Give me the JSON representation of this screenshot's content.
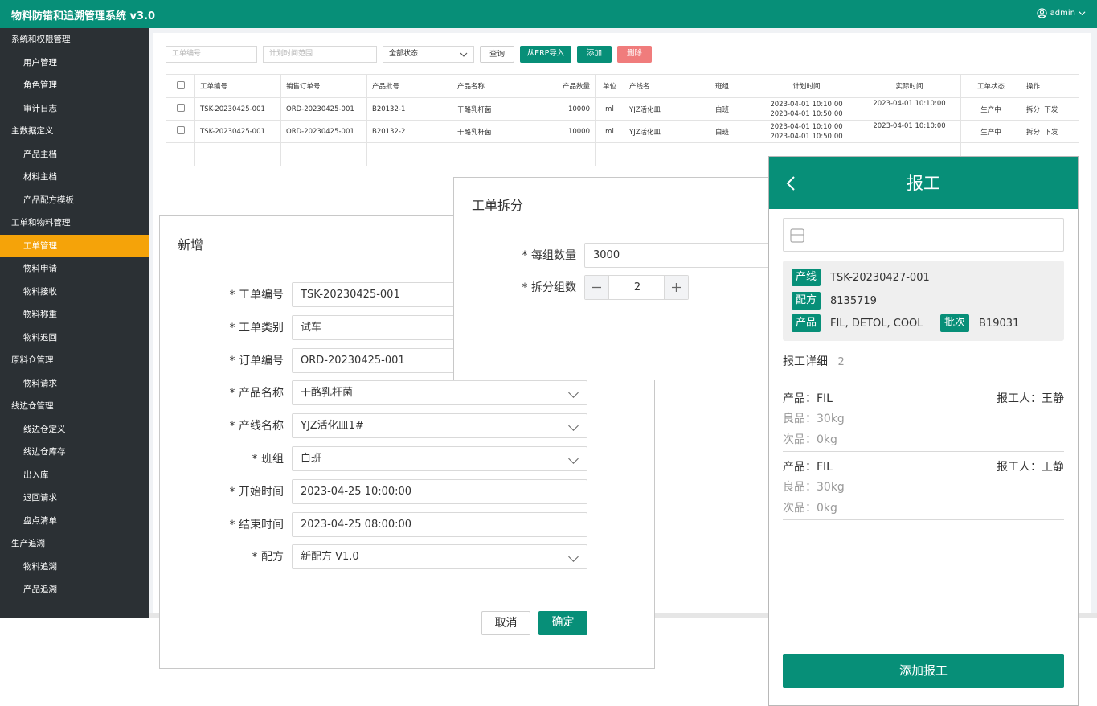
{
  "app": {
    "title": "物料防错和追溯管理系统 v3.0",
    "user": "admin"
  },
  "sidebar": {
    "items": [
      {
        "label": "系统和权限管理",
        "kind": "group"
      },
      {
        "label": "用户管理",
        "kind": "child"
      },
      {
        "label": "角色管理",
        "kind": "child"
      },
      {
        "label": "审计日志",
        "kind": "child"
      },
      {
        "label": "主数据定义",
        "kind": "group"
      },
      {
        "label": "产品主档",
        "kind": "child"
      },
      {
        "label": "材料主档",
        "kind": "child"
      },
      {
        "label": "产品配方模板",
        "kind": "child"
      },
      {
        "label": "工单和物料管理",
        "kind": "group"
      },
      {
        "label": "工单管理",
        "kind": "child",
        "active": true
      },
      {
        "label": "物料申请",
        "kind": "child"
      },
      {
        "label": "物料接收",
        "kind": "child"
      },
      {
        "label": "物料称重",
        "kind": "child"
      },
      {
        "label": "物料退回",
        "kind": "child"
      },
      {
        "label": "原料仓管理",
        "kind": "group"
      },
      {
        "label": "物料请求",
        "kind": "child"
      },
      {
        "label": "线边仓管理",
        "kind": "group"
      },
      {
        "label": "线边仓定义",
        "kind": "child"
      },
      {
        "label": "线边仓库存",
        "kind": "child"
      },
      {
        "label": "出入库",
        "kind": "child"
      },
      {
        "label": "退回请求",
        "kind": "child"
      },
      {
        "label": "盘点清单",
        "kind": "child"
      },
      {
        "label": "生产追溯",
        "kind": "group"
      },
      {
        "label": "物料追溯",
        "kind": "child"
      },
      {
        "label": "产品追溯",
        "kind": "child"
      }
    ]
  },
  "filters": {
    "work_order_placeholder": "工单编号",
    "plan_time_placeholder": "计划时间范围",
    "status_value": "全部状态",
    "query_label": "查询",
    "erp_import_label": "从ERP导入",
    "add_label": "添加",
    "delete_label": "删除"
  },
  "table": {
    "headers": [
      "工单编号",
      "销售订单号",
      "产品批号",
      "产品名称",
      "产品数量",
      "单位",
      "产线名",
      "班组",
      "计划时间",
      "实际时间",
      "工单状态",
      "操作"
    ],
    "rows": [
      {
        "wo": "TSK-20230425-001",
        "so": "ORD-20230425-001",
        "batch": "B20132-1",
        "product": "干酪乳杆菌",
        "qty": "10000",
        "unit": "ml",
        "line": "YJZ活化皿",
        "shift": "白班",
        "plan_start": "2023-04-01 10:10:00",
        "plan_end": "2023-04-01 10:50:00",
        "actual": "2023-04-01 10:10:00",
        "status": "生产中",
        "op_split": "拆分",
        "op_issue": "下发"
      },
      {
        "wo": "TSK-20230425-001",
        "so": "ORD-20230425-001",
        "batch": "B20132-2",
        "product": "干酪乳杆菌",
        "qty": "10000",
        "unit": "ml",
        "line": "YJZ活化皿",
        "shift": "白班",
        "plan_start": "2023-04-01 10:10:00",
        "plan_end": "2023-04-01 10:50:00",
        "actual": "2023-04-01 10:10:00",
        "status": "生产中",
        "op_split": "拆分",
        "op_issue": "下发"
      }
    ]
  },
  "add_dialog": {
    "title": "新增",
    "fields": [
      {
        "label": "* 工单编号",
        "value": "TSK-20230425-001",
        "select": false
      },
      {
        "label": "* 工单类别",
        "value": "试车",
        "select": false
      },
      {
        "label": "* 订单编号",
        "value": "ORD-20230425-001",
        "select": false
      },
      {
        "label": "* 产品名称",
        "value": "干酪乳杆菌",
        "select": true
      },
      {
        "label": "* 产线名称",
        "value": "YJZ活化皿1#",
        "select": true
      },
      {
        "label": "* 班组",
        "value": "白班",
        "select": true
      },
      {
        "label": "* 开始时间",
        "value": "2023-04-25 10:00:00",
        "select": false
      },
      {
        "label": "* 结束时间",
        "value": "2023-04-25 08:00:00",
        "select": false
      },
      {
        "label": "* 配方",
        "value": "新配方 V1.0",
        "select": true
      }
    ],
    "cancel_label": "取消",
    "confirm_label": "确定"
  },
  "split_dialog": {
    "title": "工单拆分",
    "per_group_label": "* 每组数量",
    "per_group_value": "3000",
    "groups_label": "* 拆分组数",
    "groups_value": "2"
  },
  "report_panel": {
    "title": "报工",
    "info": {
      "line_tag": "产线",
      "line_value": "TSK-20230427-001",
      "recipe_tag": "配方",
      "recipe_value": "8135719",
      "product_tag": "产品",
      "product_value": "FIL, DETOL, COOL",
      "batch_tag": "批次",
      "batch_value": "B19031"
    },
    "detail_label": "报工详细",
    "detail_count": "2",
    "records": [
      {
        "product": "产品：FIL",
        "reporter": "报工人：王静",
        "good": "良品：30kg",
        "defect": "次品：0kg"
      },
      {
        "product": "产品：FIL",
        "reporter": "报工人：王静",
        "good": "良品：30kg",
        "defect": "次品：0kg"
      }
    ],
    "add_button": "添加报工"
  },
  "colors": {
    "brand": "#078f78",
    "active": "#f5a309",
    "danger": "#f07c7c",
    "sidebar": "#2b3034"
  }
}
